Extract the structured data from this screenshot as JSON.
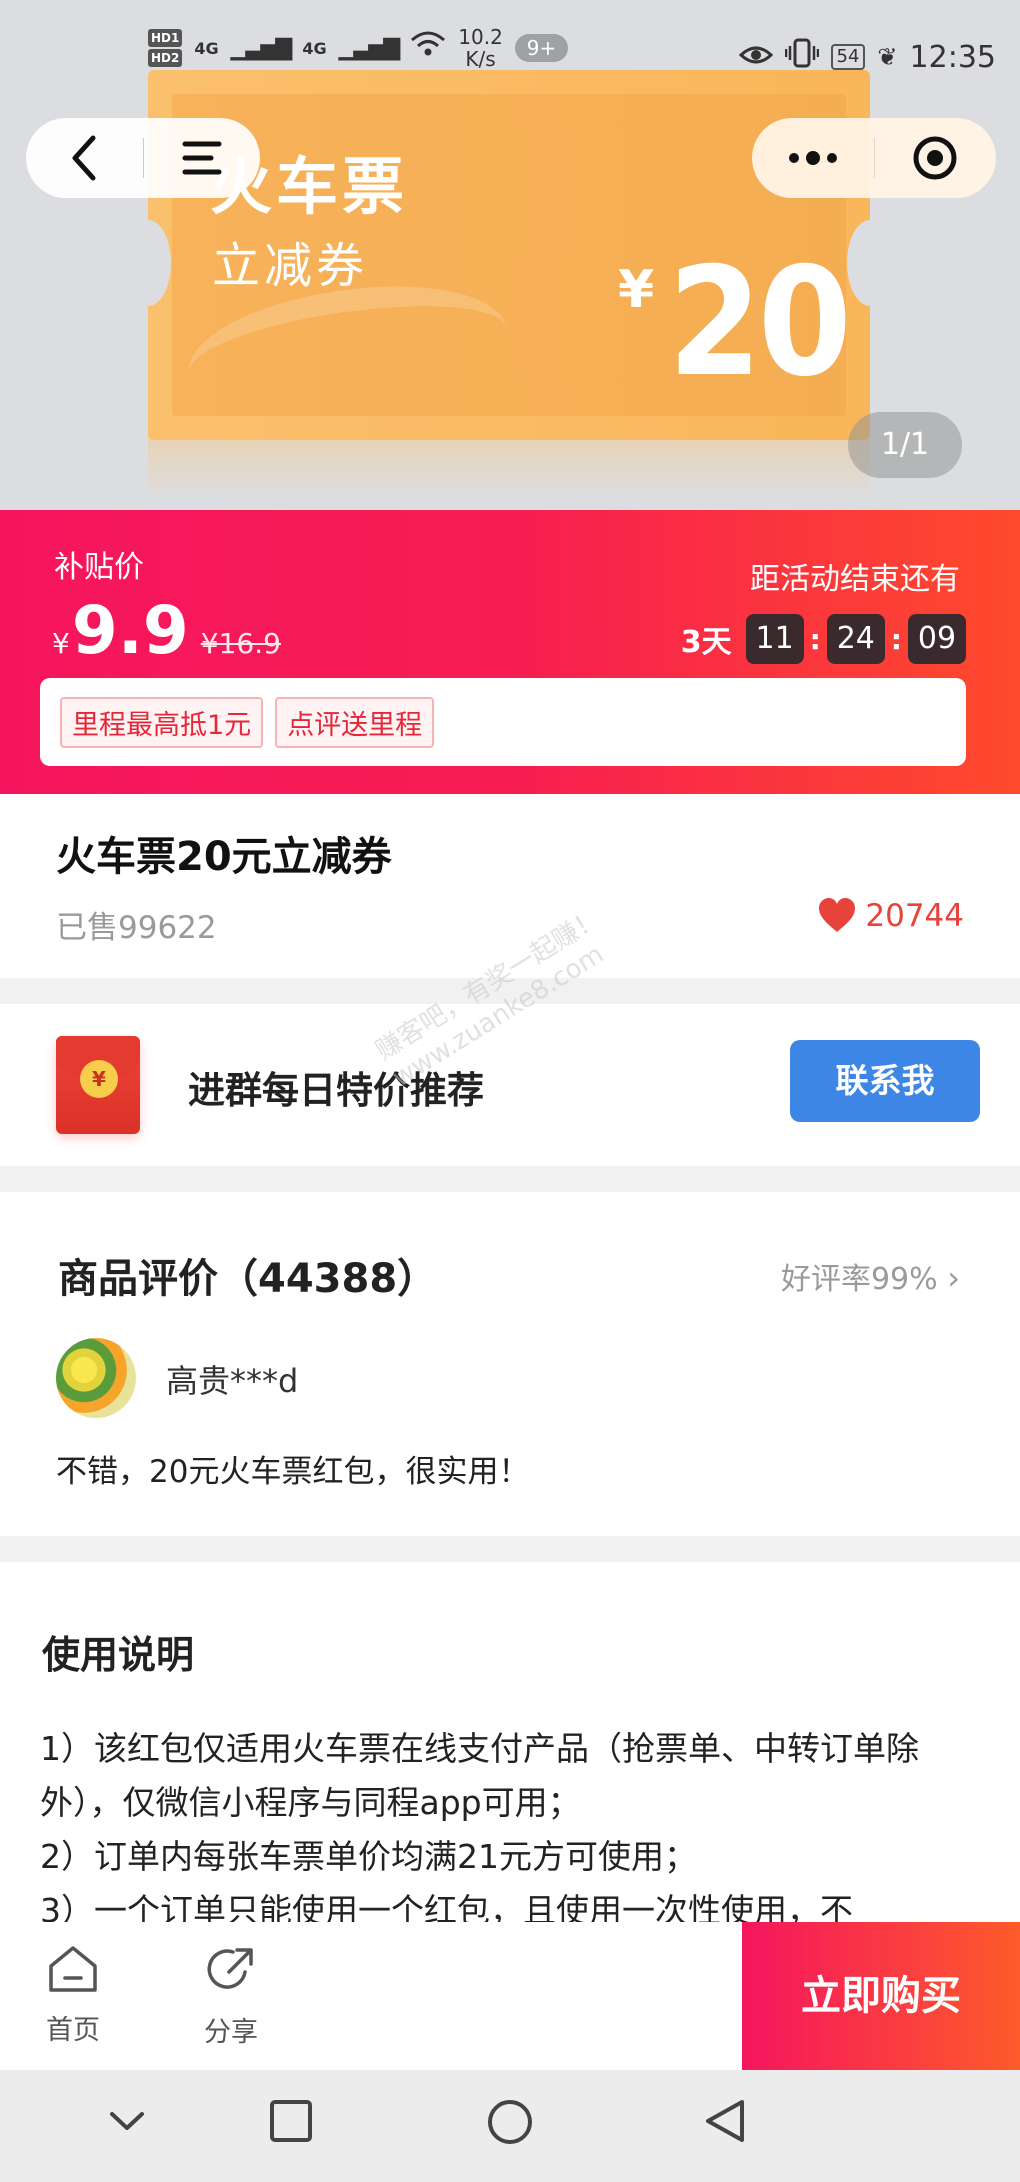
{
  "status_bar": {
    "hd1": "HD1",
    "hd2": "HD2",
    "net1": "4G",
    "net2": "4G",
    "speed_value": "10.2",
    "speed_unit": "K/s",
    "notif_badge": "9+",
    "battery": "54",
    "time": "12:35"
  },
  "hero": {
    "ticket_title": "火车票",
    "ticket_subtitle": "立减券",
    "ticket_currency": "¥",
    "ticket_amount": "20",
    "pager": "1/1"
  },
  "nav": {
    "back_icon": "chevron-left-icon",
    "menu_icon": "menu-icon",
    "more_icon": "more-dots-icon",
    "close_icon": "target-circle-icon"
  },
  "price_banner": {
    "label": "补贴价",
    "currency": "¥",
    "price": "9.9",
    "original_price": "¥16.9",
    "ends_label": "距活动结束还有",
    "days": "3天",
    "hours": "11",
    "minutes": "24",
    "seconds": "09",
    "tags": [
      "里程最高抵1元",
      "点评送里程"
    ]
  },
  "product": {
    "title": "火车票20元立减券",
    "sold": "已售99622",
    "favorites": "20744",
    "favorite_color": "#e8433b"
  },
  "group": {
    "text": "进群每日特价推荐",
    "button": "联系我",
    "coin": "¥",
    "watermark_line1": "赚客吧，有奖一起赚！",
    "watermark_line2": "www.zuanke8.com"
  },
  "reviews": {
    "title": "商品评价（44388）",
    "rate": "好评率99%",
    "reviewer": "高贵***d",
    "text": "不错，20元火车票红包，很实用！"
  },
  "usage": {
    "title": "使用说明",
    "lines": [
      "1）该红包仅适用火车票在线支付产品（抢票单、中转订单除外），仅微信小程序与同程app可用；",
      "2）订单内每张车票单价均满21元方可使用；",
      "3）一个订单只能使用一个红包，且使用一次性使用，不"
    ]
  },
  "bottom_bar": {
    "home": "首页",
    "share": "分享",
    "buy": "立即购买"
  },
  "colors": {
    "accent_red": "#f5155e",
    "accent_orange": "#fe4a2c",
    "button_blue": "#3d86e6",
    "ticket_orange": "#f7b25a"
  }
}
